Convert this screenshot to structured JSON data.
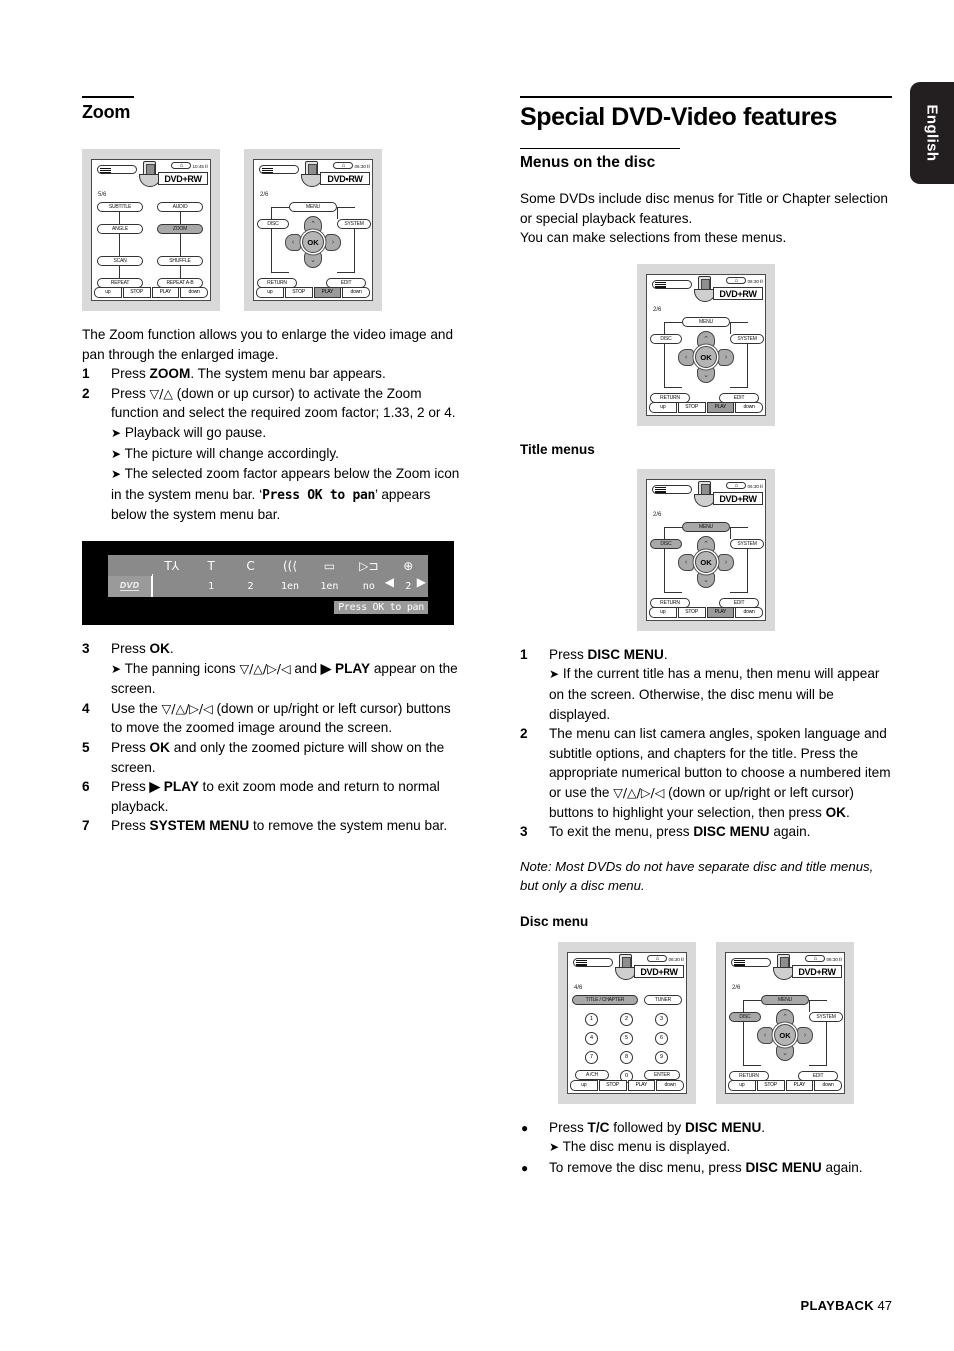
{
  "language_tab": {
    "label": "English"
  },
  "footer": {
    "section": "PLAYBACK",
    "page_number": "47"
  },
  "left_column": {
    "heading": "Zoom",
    "intro": "The Zoom function allows you to enlarge the video image and pan through the enlarged image.",
    "steps": [
      {
        "num": "1",
        "text_html": "Press <b>ZOOM</b>. The system menu bar appears."
      },
      {
        "num": "2",
        "text_html": "Press <span class=\"cursors\">▽/△</span> (down or up cursor) to activate the Zoom function and select the required zoom factor; 1.33, 2 or 4."
      },
      {
        "num": "",
        "arrow": "➤",
        "text_html": "Playback will go pause."
      },
      {
        "num": "",
        "arrow": "➤",
        "text_html": "The picture will change accordingly."
      },
      {
        "num": "",
        "arrow": "➤",
        "text_html": "The selected zoom factor appears below the Zoom icon in the system menu bar. ‘<span class=\"ocr-font\">Press OK to pan</span>’ appears below the system menu bar."
      },
      {
        "num": "3",
        "text_html": "Press <b>OK</b>."
      },
      {
        "num": "",
        "arrow": "➤",
        "text_html": "The panning icons <span class=\"cursors\">▽/△/▷/◁</span> and <b>▶ PLAY</b> appear on the screen."
      },
      {
        "num": "4",
        "text_html": "Use the <span class=\"cursors\">▽/△/▷/◁</span> (down or up/right or left cursor) buttons to move the zoomed image around the screen."
      },
      {
        "num": "5",
        "text_html": "Press <b>OK</b> and only the zoomed picture will show on the screen."
      },
      {
        "num": "6",
        "text_html": "Press <b>▶ PLAY</b> to exit zoom mode and return to normal playback."
      },
      {
        "num": "7",
        "text_html": "Press <b>SYSTEM MENU</b> to remove the system menu bar."
      }
    ],
    "remote_zoom": {
      "page_indicator": "5/6",
      "clock": "10:45",
      "disc_label": "DVD+RW",
      "buttons": [
        "SUBTITLE",
        "AUDIO",
        "ANGLE",
        "ZOOM",
        "SCAN",
        "SHUFFLE",
        "REPEAT",
        "REPEAT A-B"
      ],
      "selected_button": "ZOOM",
      "bottom_bar": [
        "up",
        "STOP",
        "PLAY",
        "down"
      ],
      "bottom_selected": ""
    },
    "remote_nav": {
      "page_indicator": "2/6",
      "clock": "06:30",
      "disc_label": "DVD•RW",
      "buttons": [
        "MENU",
        "DISC",
        "SYSTEM",
        "RETURN",
        "EDIT"
      ],
      "selected_button": "",
      "ok_label": "OK",
      "bottom_bar": [
        "up",
        "STOP",
        "PLAY",
        "down"
      ],
      "bottom_selected": "PLAY"
    },
    "osd": {
      "icons": [
        "T⅄",
        "T",
        "C",
        "((⟨",
        "▭",
        "▷⊐",
        "⊕"
      ],
      "values": [
        "",
        "1",
        "2",
        "1en",
        "1en",
        "no",
        "2"
      ],
      "disc_tag": "DVD",
      "tooltip": "Press OK to pan",
      "left_arrow": "◀",
      "right_arrow": "▶"
    }
  },
  "right_column": {
    "heading": "Special DVD-Video features",
    "subheading": "Menus on the disc",
    "intro": "Some DVDs include disc menus for Title or Chapter selection or special playback features.\nYou can make selections from these menus.",
    "title_menus_heading": "Title menus",
    "title_menus_steps": [
      {
        "num": "1",
        "text_html": "Press <b>DISC MENU</b>."
      },
      {
        "num": "",
        "arrow": "➤",
        "text_html": "If the current title has a menu, then menu will appear on the screen. Otherwise, the disc menu will be displayed."
      },
      {
        "num": "2",
        "text_html": "The menu can list camera angles, spoken language and subtitle options, and chapters for the title. Press the appropriate numerical button to choose a numbered item or use the <span class=\"cursors\">▽/△/▷/◁</span> (down or up/right or left cursor) buttons to highlight your selection, then press <b>OK</b>."
      },
      {
        "num": "3",
        "text_html": "To exit the menu, press <b>DISC MENU</b> again."
      }
    ],
    "note": "Note: Most DVDs do not have separate disc and title menus, but only a disc menu.",
    "disc_menu_heading": "Disc menu",
    "disc_menu_bullets": [
      {
        "bullet": "●",
        "text_html": "Press <b>T/C</b> followed by <b>DISC MENU</b>."
      },
      {
        "bullet": "",
        "arrow": "➤",
        "text_html": "The disc menu is displayed."
      },
      {
        "bullet": "●",
        "text_html": "To remove the disc menu, press <b>DISC MENU</b> again."
      }
    ],
    "remote_menus": {
      "page_indicator": "2/6",
      "clock": "06:30",
      "disc_label": "DVD+RW",
      "buttons": [
        "MENU",
        "DISC",
        "SYSTEM",
        "RETURN",
        "EDIT"
      ],
      "selected_button": "",
      "ok_label": "OK",
      "bottom_bar": [
        "up",
        "STOP",
        "PLAY",
        "down"
      ],
      "bottom_selected": "PLAY"
    },
    "remote_title": {
      "page_indicator": "2/6",
      "clock": "06:30",
      "disc_label": "DVD+RW",
      "buttons": [
        "MENU",
        "DISC",
        "SYSTEM",
        "RETURN",
        "EDIT"
      ],
      "selected_button": "MENU,DISC",
      "ok_label": "OK",
      "bottom_bar": [
        "up",
        "STOP",
        "PLAY",
        "down"
      ],
      "bottom_selected": "PLAY"
    },
    "remote_numeric": {
      "page_indicator": "4/6",
      "clock": "06:30",
      "disc_label": "DVD+RW",
      "buttons": [
        "TITLE / CHAPTER",
        "TUNER",
        "A /CH",
        "ENTER"
      ],
      "selected_button": "TITLE / CHAPTER",
      "numbers": [
        "1",
        "2",
        "3",
        "4",
        "5",
        "6",
        "7",
        "8",
        "9",
        "0"
      ],
      "bottom_bar": [
        "up",
        "STOP",
        "PLAY",
        "down"
      ],
      "bottom_selected": ""
    },
    "remote_disc": {
      "page_indicator": "2/6",
      "clock": "06:30",
      "disc_label": "DVD+RW",
      "buttons": [
        "MENU",
        "DISC",
        "SYSTEM",
        "RETURN",
        "EDIT"
      ],
      "selected_button": "MENU,DISC",
      "ok_label": "OK",
      "bottom_bar": [
        "up",
        "STOP",
        "PLAY",
        "down"
      ],
      "bottom_selected": ""
    }
  }
}
